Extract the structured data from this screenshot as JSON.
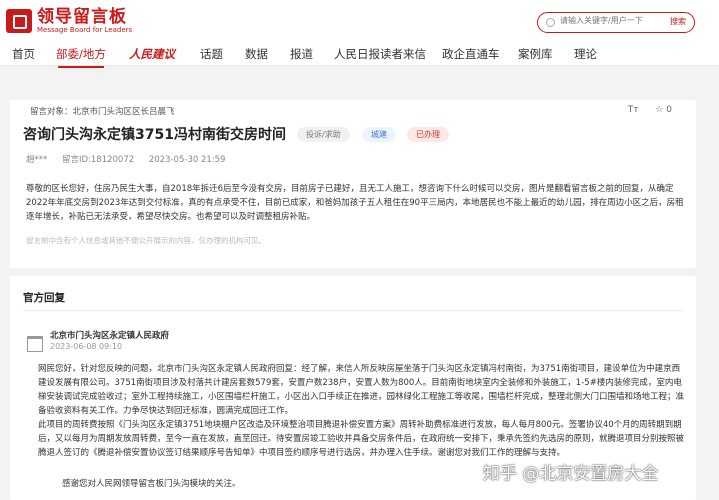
{
  "site": {
    "logo_cn": "领导留言板",
    "logo_en": "Message Board for Leaders",
    "search_placeholder": "请输入关键字/用户一下",
    "search_button": "搜索"
  },
  "nav": [
    "首页",
    "部委/地方",
    "人民建议",
    "话题",
    "数据",
    "报道",
    "人民日报读者来信",
    "政企直通车",
    "案例库",
    "理论"
  ],
  "question": {
    "target": "留言对象：北京市门头沟区区长吕晨飞",
    "font_tool": "Tт",
    "fav_count": "☆ 0",
    "title": "咨询门头沟永定镇3751冯村南街交房时间",
    "tag_type": "投诉/求助",
    "tag_domain": "城建",
    "tag_status": "已办理",
    "user": "趙***",
    "msg_id": "留言ID:18120072",
    "time": "2023-05-30 21:59",
    "body": "尊敬的区长您好，住房乃民生大事，自2018年拆迁6后至今没有交房，目前房子已建好，且无工人施工，想咨询下什么时候可以交房，图片是翻看留言板之前的回复，从确定2022年年底交房到2023年达到交付标准，真的有点承受不住，目前已成家，和爸妈加孩子五人租住在90平三局内，本地居民也不能上最近的幼儿园，排在周边小区之后，房租逐年增长，补贴已无法承受，希望尽快交房。也希望可以及时调整租房补贴。",
    "note": "留言前中含有个人信息或其他不便公开展示的内容，仅办理的机构可见。"
  },
  "answer": {
    "section_title": "官方回复",
    "org": "北京市门头沟区永定镇人民政府",
    "date": "2023-06-08 09:10",
    "para1": "网民您好，针对您反映的问题，北京市门头沟区永定镇人民政府回复：经了解，来信人所反映房屋坐落于门头沟区永定镇冯村南街，为3751南街项目，建设单位为中建京西建设发展有限公司。3751南街项目涉及村落共计建房套数579套，安置户数238户，安置人数为800人。目前南街地块室内全装修和外装施工，1-5#楼内装修完成，室内电梯安装调试完成验收过；室外工程持续施工，小区围墙栏杆施工，小区出入口手续正在推进，园林绿化工程施工等收尾，围墙栏杆完成，整理北侧大门口围墙和场地工程；准备验收资料有关工作。力争尽快达到回迁标准，圆满完成回迁工作。",
    "para2": "此项目的周转费按照《门头沟区永定镇3751地块棚户区改造及环境整治项目腾退补偿安置方案》周转补助费标准进行发放，每人每月800元。签署协议40个月的周转期到期后，又以每月为周期发放周转费，至今一直在发放，直至回迁。待安置房竣工验收并具备交房条件后，在政府统一安排下，秉承先签约先选房的原则，就腾退项目分别按照被腾退人签订的《腾退补偿安置协议签订结果顺序号告知单》中项目签约顺序号进行选房，并办理入住手续。谢谢您对我们工作的理解与支持。",
    "thanks": "感谢您对人民网领导留言板门头沟模块的关注。"
  },
  "watermark": "知乎 @北京安置房大全"
}
